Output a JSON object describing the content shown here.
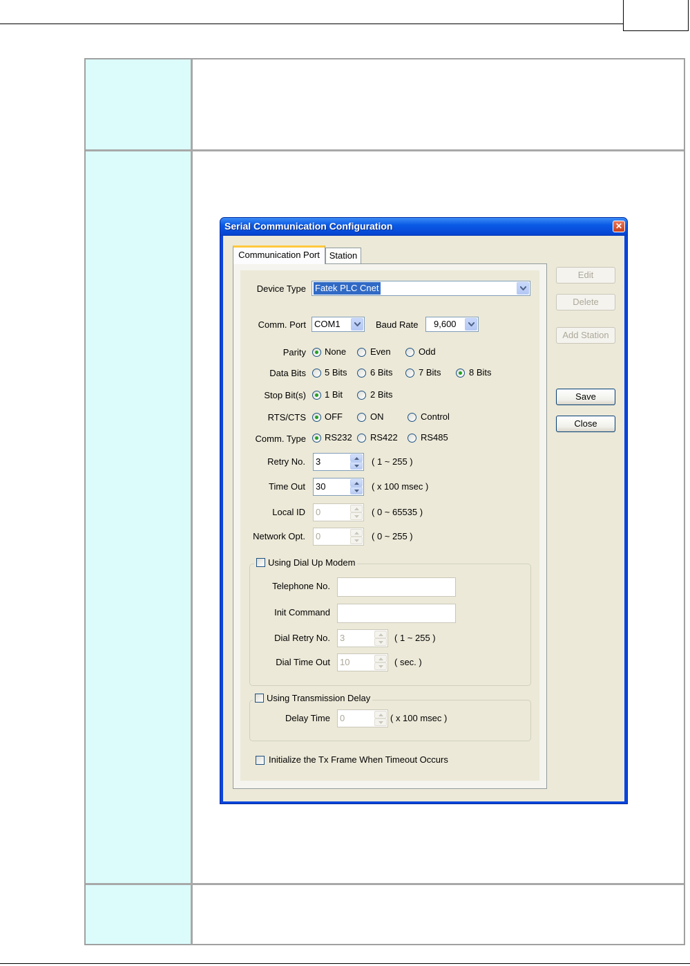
{
  "dialog": {
    "title": "Serial Communication Configuration",
    "close_glyph": "✕",
    "tabs": [
      "Communication Port",
      "Station"
    ],
    "side_buttons": {
      "edit": "Edit",
      "delete": "Delete",
      "add_station": "Add Station",
      "save": "Save",
      "close": "Close"
    },
    "device_type": {
      "label": "Device Type",
      "value": "Fatek PLC Cnet"
    },
    "comm_port": {
      "label": "Comm. Port",
      "value": "COM1"
    },
    "baud_rate": {
      "label": "Baud Rate",
      "value": "9,600"
    },
    "parity": {
      "label": "Parity",
      "options": [
        "None",
        "Even",
        "Odd"
      ],
      "selected": "None"
    },
    "data_bits": {
      "label": "Data Bits",
      "options": [
        "5 Bits",
        "6 Bits",
        "7 Bits",
        "8 Bits"
      ],
      "selected": "8 Bits"
    },
    "stop_bits": {
      "label": "Stop Bit(s)",
      "options": [
        "1 Bit",
        "2 Bits"
      ],
      "selected": "1 Bit"
    },
    "rts_cts": {
      "label": "RTS/CTS",
      "options": [
        "OFF",
        "ON",
        "Control"
      ],
      "selected": "OFF"
    },
    "comm_type": {
      "label": "Comm. Type",
      "options": [
        "RS232",
        "RS422",
        "RS485"
      ],
      "selected": "RS232"
    },
    "retry_no": {
      "label": "Retry No.",
      "value": "3",
      "range": "( 1 ~ 255 )"
    },
    "time_out": {
      "label": "Time Out",
      "value": "30",
      "range": "( x 100 msec )"
    },
    "local_id": {
      "label": "Local ID",
      "value": "0",
      "range": "( 0 ~ 65535 )"
    },
    "network_opt": {
      "label": "Network Opt.",
      "value": "0",
      "range": "( 0 ~ 255 )"
    },
    "dial_up": {
      "label": "Using Dial Up Modem",
      "checked": false,
      "telephone_label": "Telephone No.",
      "telephone_value": "",
      "init_label": "Init Command",
      "init_value": "",
      "dial_retry_label": "Dial Retry No.",
      "dial_retry_value": "3",
      "dial_retry_range": "( 1 ~ 255 )",
      "dial_timeout_label": "Dial Time Out",
      "dial_timeout_value": "10",
      "dial_timeout_range": "( sec. )"
    },
    "tx_delay": {
      "label": "Using Transmission Delay",
      "checked": false,
      "delay_label": "Delay Time",
      "delay_value": "0",
      "delay_range": "( x 100 msec )"
    },
    "init_tx": {
      "label": "Initialize the Tx Frame When Timeout  Occurs",
      "checked": false
    }
  },
  "colors": {
    "table_left_fill": "#dcfcfc",
    "titlebar_blue": "#0a5ae6",
    "dialog_face": "#ece9d8",
    "selection": "#316ac5",
    "radio_dot": "#21a121",
    "tab_highlight": "#ffc83c"
  }
}
